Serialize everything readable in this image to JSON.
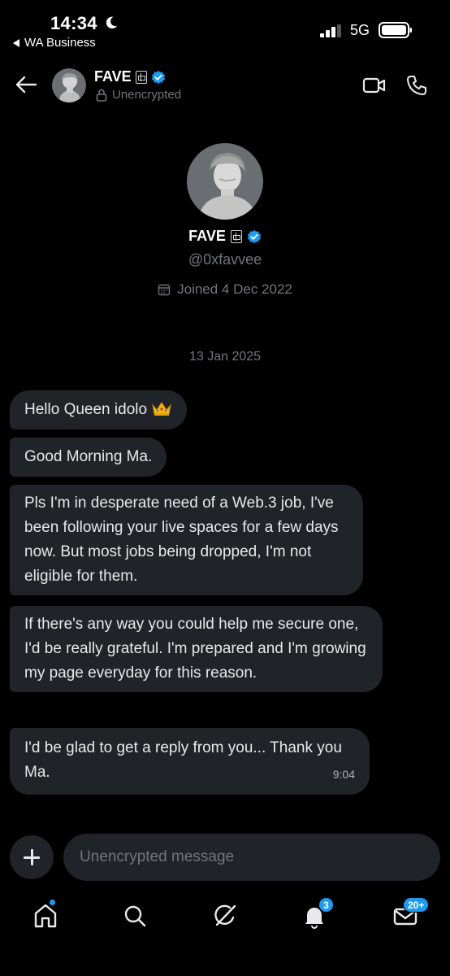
{
  "status_bar": {
    "time": "14:34",
    "back_app": "WA Business",
    "network": "5G"
  },
  "header": {
    "name": "FAVE",
    "subtitle": "Unencrypted"
  },
  "profile": {
    "name": "FAVE",
    "handle": "@0xfavvee",
    "joined": "Joined 4 Dec 2022"
  },
  "conversation": {
    "date": "13 Jan 2025",
    "messages": [
      {
        "text": "Hello Queen idolo"
      },
      {
        "text": "Good Morning Ma."
      },
      {
        "text": "Pls I'm in desperate need of a Web.3 job, I've been following your live spaces for a few days now. But most jobs being dropped, I'm not eligible for them."
      },
      {
        "text": "If there's any way you could help me secure one, I'd be really grateful. I'm prepared and I'm growing my page everyday for this reason."
      },
      {
        "text": "I'd be glad to get a reply from you... Thank you Ma.",
        "time": "9:04"
      }
    ]
  },
  "composer": {
    "placeholder": "Unencrypted message"
  },
  "bottom_nav": {
    "notifications_badge": "3",
    "messages_badge": "20+"
  },
  "colors": {
    "background": "#000000",
    "bubble": "#202327",
    "accent": "#1d9bf0",
    "muted": "#71767b"
  },
  "icons": [
    "moon-icon",
    "signal-icon",
    "battery-icon",
    "back-arrow-icon",
    "lock-icon",
    "verified-icon",
    "video-call-icon",
    "phone-call-icon",
    "calendar-icon",
    "crown-emoji",
    "plus-icon",
    "home-icon",
    "search-icon",
    "grok-icon",
    "bell-icon",
    "mail-icon"
  ]
}
